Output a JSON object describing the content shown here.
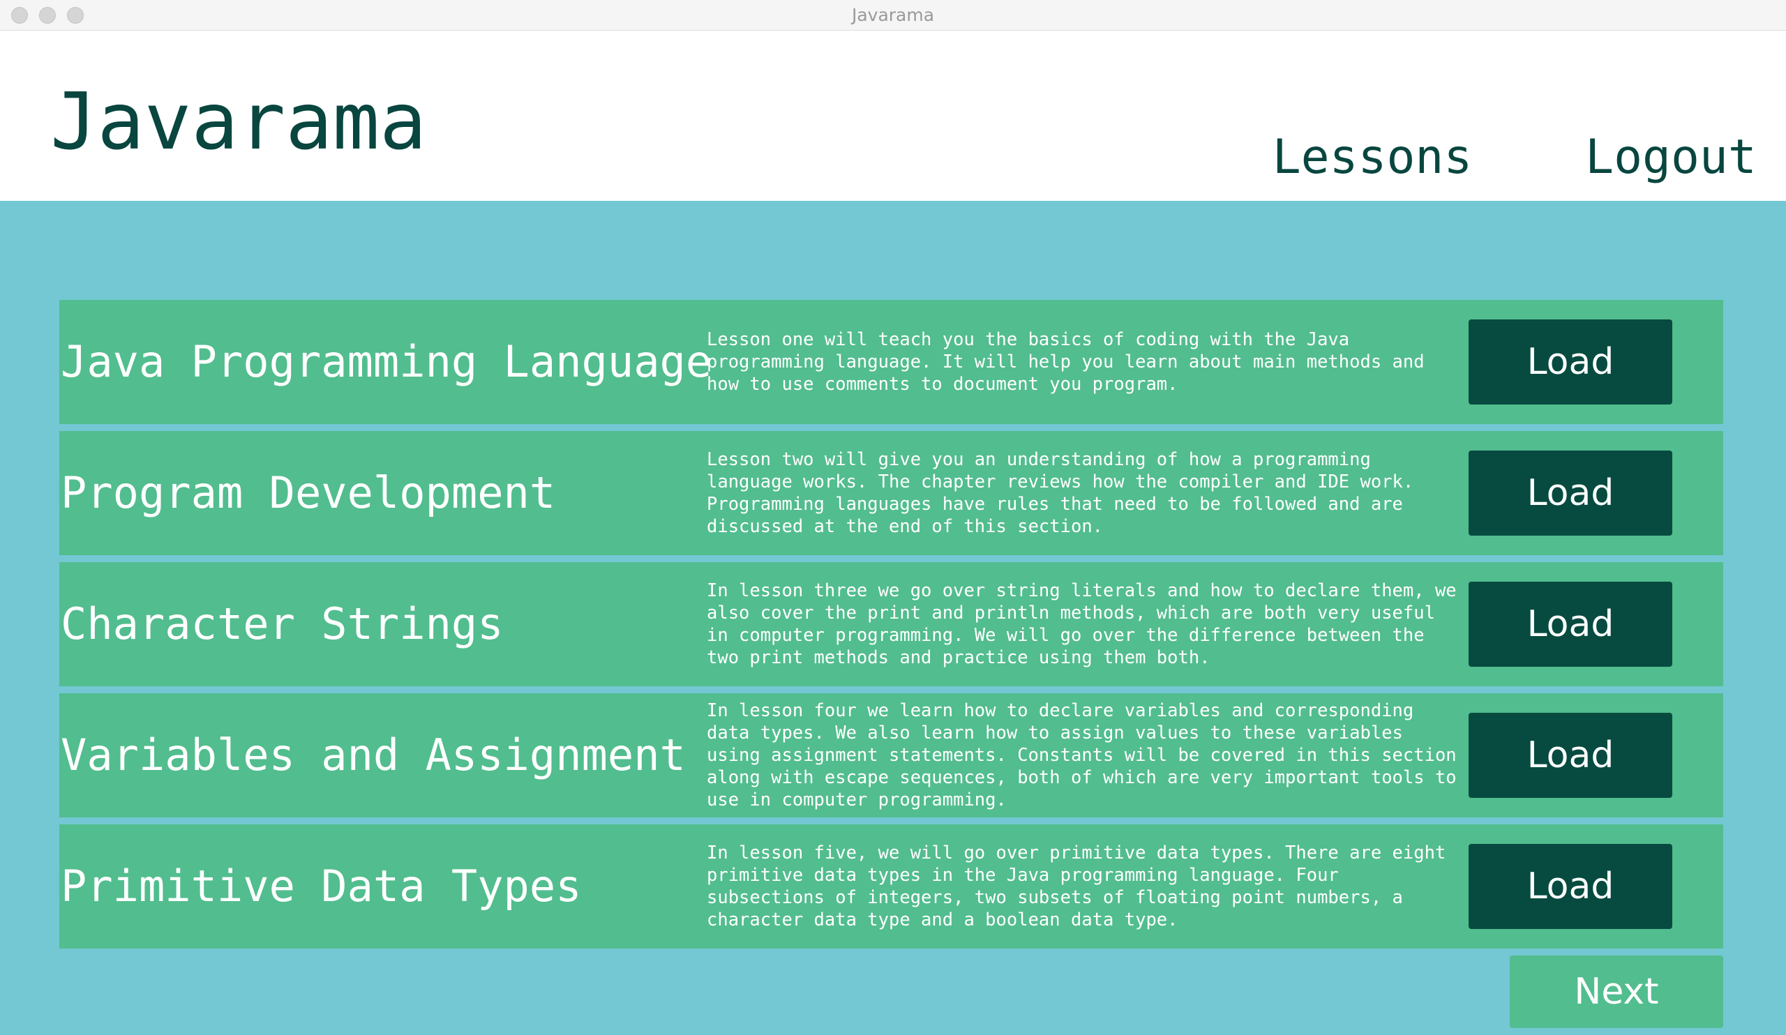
{
  "window": {
    "title": "Javarama"
  },
  "header": {
    "app_title": "Javarama",
    "nav": [
      {
        "label": "Lessons"
      },
      {
        "label": "Logout"
      }
    ]
  },
  "lessons": [
    {
      "title": "Java Programming Language",
      "description": "Lesson one will teach you the basics of coding with the Java programming language. It will help you learn about main methods and how to use comments to document you program.",
      "button_label": "Load"
    },
    {
      "title": "Program Development",
      "description": "Lesson two will give you an understanding of how a programming language works. The chapter reviews how the compiler and IDE work. Programming languages have rules that need to be followed and are discussed at the end of this section.",
      "button_label": "Load"
    },
    {
      "title": "Character Strings",
      "description": "In lesson three we go over string literals and how to declare them, we also cover the print and println methods, which are both very useful in computer programming. We will go over the difference between the two print methods and practice using them both.",
      "button_label": "Load"
    },
    {
      "title": "Variables and Assignment",
      "description": "In lesson four we learn how to declare variables and corresponding data types. We also learn how to assign values to these variables using assignment statements. Constants will be covered in this section along with escape sequences, both of which are very important tools to use in computer programming.",
      "button_label": "Load"
    },
    {
      "title": "Primitive Data Types",
      "description": "In lesson five, we will go over primitive data types. There are eight primitive data types in the Java programming language. Four subsections of integers, two subsets of floating point numbers, a character data type and a boolean data type.",
      "button_label": "Load"
    }
  ],
  "footer": {
    "next_label": "Next"
  }
}
